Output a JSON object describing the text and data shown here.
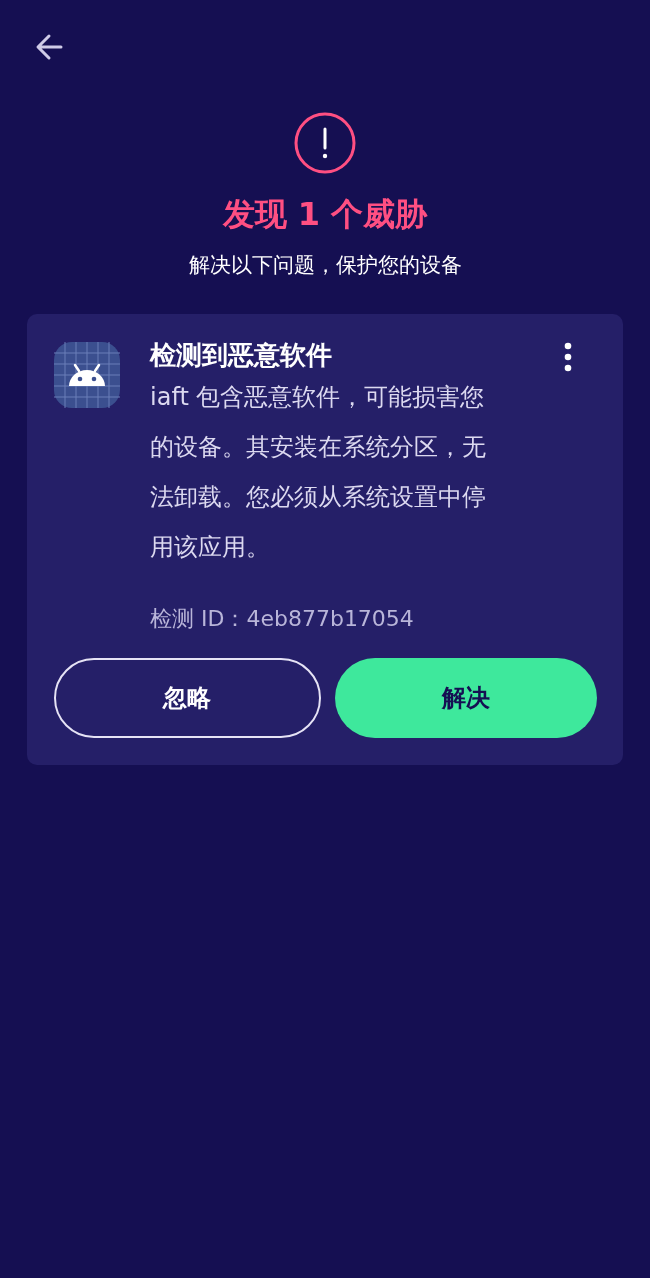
{
  "header": {
    "title": "发现 1 个威胁",
    "subtitle": "解决以下问题，保护您的设备"
  },
  "threat_card": {
    "title": "检测到恶意软件",
    "description": "iaft 包含恶意软件，可能损害您的设备。其安装在系统分区，无法卸载。您必须从系统设置中停用该应用。",
    "detection_id": "检测 ID：4eb877b17054",
    "buttons": [
      {
        "label": "忽略",
        "kind": "outline"
      },
      {
        "label": "解决",
        "kind": "primary"
      }
    ]
  }
}
